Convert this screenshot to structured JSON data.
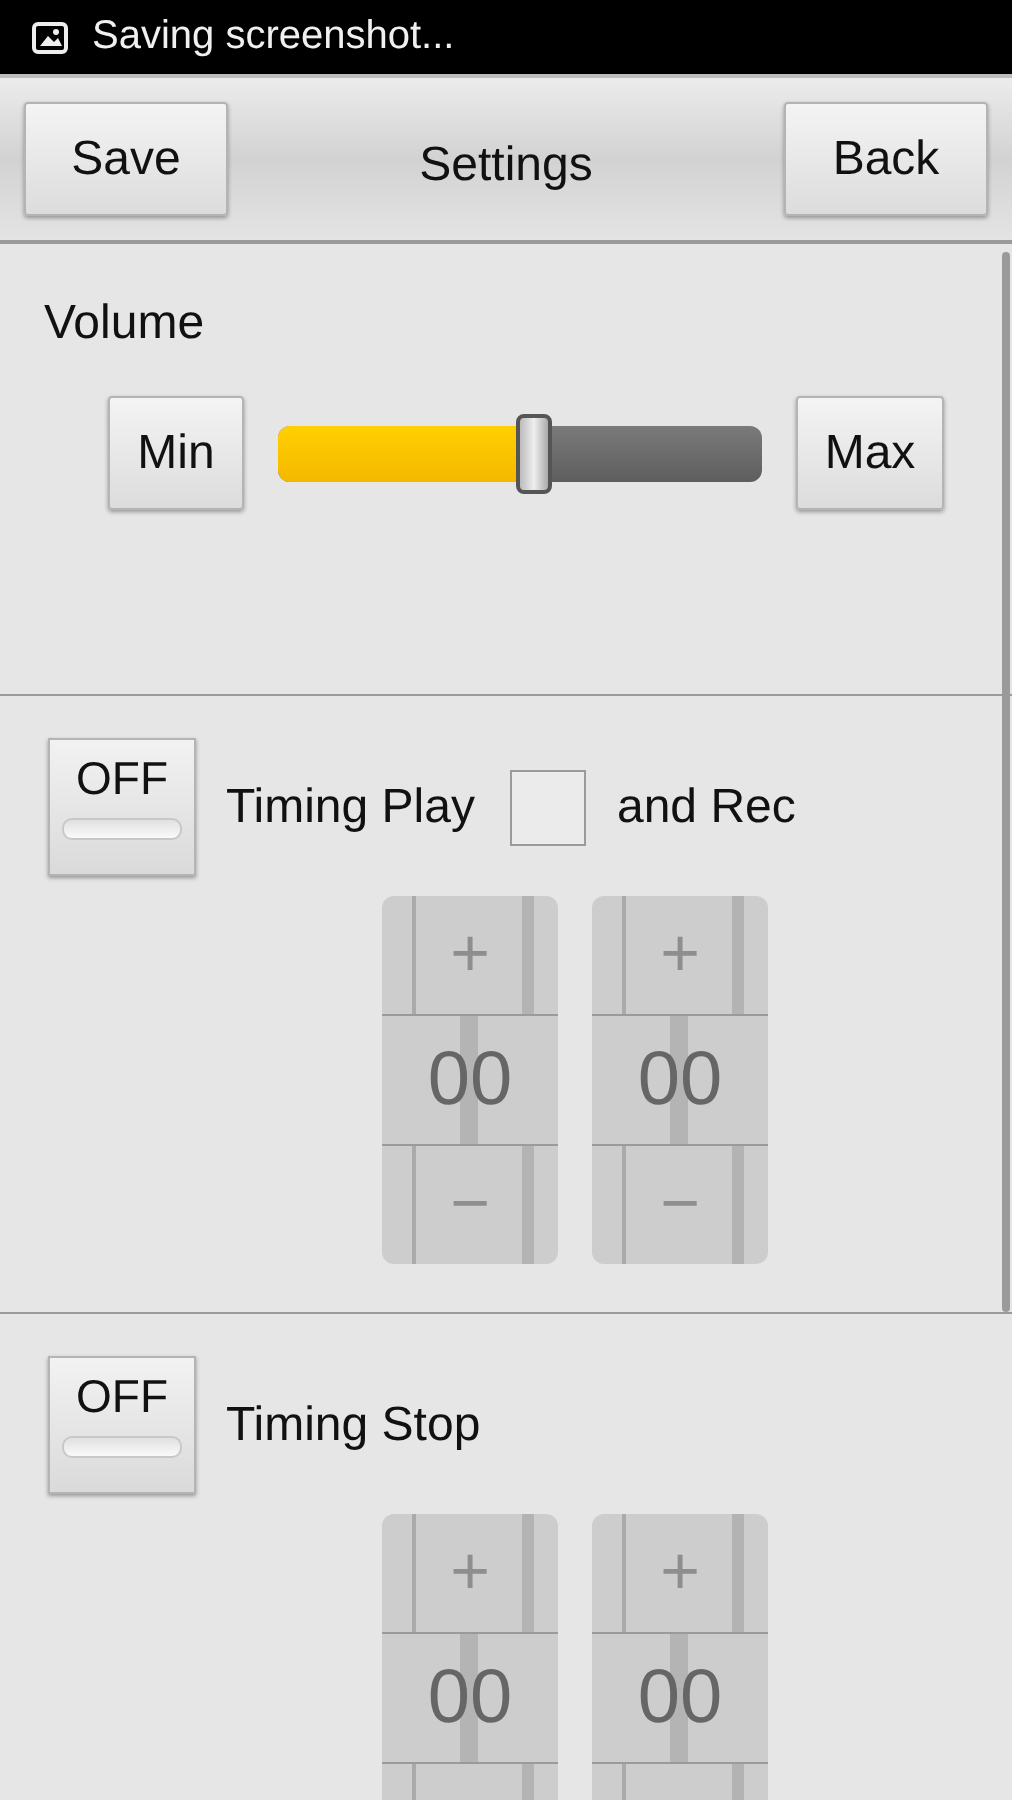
{
  "status_bar": {
    "notification": "Saving screenshot..."
  },
  "title_bar": {
    "title": "Settings",
    "left_button": "Save",
    "right_button": "Back"
  },
  "volume": {
    "label": "Volume",
    "min_button": "Min",
    "max_button": "Max",
    "level": 0.53
  },
  "timers": [
    {
      "toggle": {
        "label": "OFF",
        "on": false
      },
      "label": "Timing Play",
      "checkbox": {
        "checked": false,
        "label": "and Rec"
      },
      "pickers": [
        {
          "plus": "+",
          "value": "00",
          "minus": "−"
        },
        {
          "plus": "+",
          "value": "00",
          "minus": "−"
        }
      ]
    },
    {
      "toggle": {
        "label": "OFF",
        "on": false
      },
      "label": "Timing Stop",
      "pickers": [
        {
          "plus": "+",
          "value": "00"
        },
        {
          "plus": "+",
          "value": "00"
        }
      ]
    }
  ]
}
